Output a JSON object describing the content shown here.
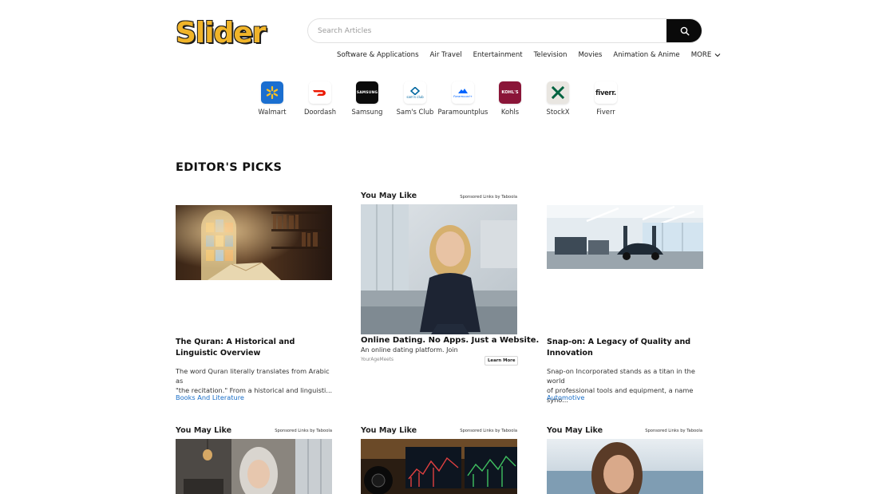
{
  "site": {
    "logo_text": "Slider"
  },
  "search": {
    "placeholder": "Search Articles"
  },
  "nav": {
    "items": [
      "Software & Applications",
      "Air Travel",
      "Entertainment",
      "Television",
      "Movies",
      "Animation & Anime"
    ],
    "more_label": "MORE"
  },
  "brands": [
    {
      "name": "Walmart",
      "icon": "walmart-spark-icon",
      "bg": "#1b6fd0"
    },
    {
      "name": "Doordash",
      "icon": "doordash-icon",
      "bg": "#ffffff"
    },
    {
      "name": "Samsung",
      "icon": "samsung-icon",
      "bg": "#0b0b0b",
      "mark": "SAMSUNG"
    },
    {
      "name": "Sam's Club",
      "icon": "sams-club-icon",
      "bg": "#ffffff",
      "mark": "sam's club"
    },
    {
      "name": "Paramountplus",
      "icon": "paramount-plus-icon",
      "bg": "#ffffff",
      "mark": "Paramount+"
    },
    {
      "name": "Kohls",
      "icon": "kohls-icon",
      "bg": "#8a1538",
      "mark": "KOHL'S"
    },
    {
      "name": "StockX",
      "icon": "stockx-icon",
      "bg": "#e9e6e1"
    },
    {
      "name": "Fiverr",
      "icon": "fiverr-icon",
      "bg": "#ffffff",
      "mark": "fiverr."
    }
  ],
  "editors_picks": {
    "title": "EDITOR'S PICKS",
    "articles": [
      {
        "title": "The Quran: A Historical and Linguistic Overview",
        "desc_line1": "The word Quran literally translates from Arabic as",
        "desc_line2": "\"the recitation.\" From a historical and linguisti...",
        "category": "Books And Literature"
      },
      {
        "title": "Snap-on: A Legacy of Quality and Innovation",
        "desc_line1": "Snap-on Incorporated stands as a titan in the world",
        "desc_line2": "of professional tools and equipment, a name syno...",
        "category": "Automotive"
      }
    ],
    "sponsored": {
      "header": "You May Like",
      "by": "Sponsored Links by Taboola",
      "title": "Online Dating. No Apps. Just a Website.",
      "desc": "An online dating platform. Join",
      "source": "YourAgeMeets",
      "button": "Learn More"
    }
  },
  "bottom_ads": [
    {
      "header": "You May Like",
      "by": "Sponsored Links by Taboola"
    },
    {
      "header": "You May Like",
      "by": "Sponsored Links by Taboola"
    },
    {
      "header": "You May Like",
      "by": "Sponsored Links by Taboola"
    }
  ]
}
